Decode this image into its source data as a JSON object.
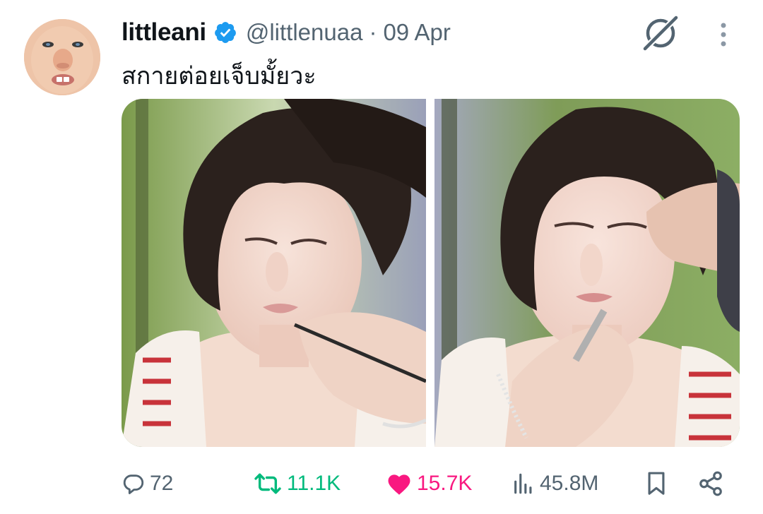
{
  "tweet": {
    "author": {
      "display_name": "littleani",
      "handle": "@littlenuaa",
      "verified": true,
      "avatar_icon": "avatar-photo"
    },
    "separator": "·",
    "date": "09 Apr",
    "text": "สกายต่อยเจ็บมั้ยวะ",
    "media": [
      {
        "type": "photo",
        "alt_icon": "makeup-photo"
      },
      {
        "type": "photo",
        "alt_icon": "makeup-photo"
      }
    ],
    "actions": {
      "replies": "72",
      "reposts": "11.1K",
      "likes": "15.7K",
      "views": "45.8M",
      "liked": true,
      "reposted": true
    }
  },
  "colors": {
    "text_primary": "#0f1419",
    "text_secondary": "#536471",
    "verified_blue": "#1d9bf0",
    "repost_green": "#00ba7c",
    "like_pink": "#f91880"
  },
  "icons": {
    "verified": "verified-badge-icon",
    "grok": "grok-icon",
    "more": "more-vertical-icon",
    "reply": "reply-icon",
    "repost": "repost-icon",
    "like": "heart-icon",
    "views": "views-icon",
    "bookmark": "bookmark-icon",
    "share": "share-icon"
  }
}
